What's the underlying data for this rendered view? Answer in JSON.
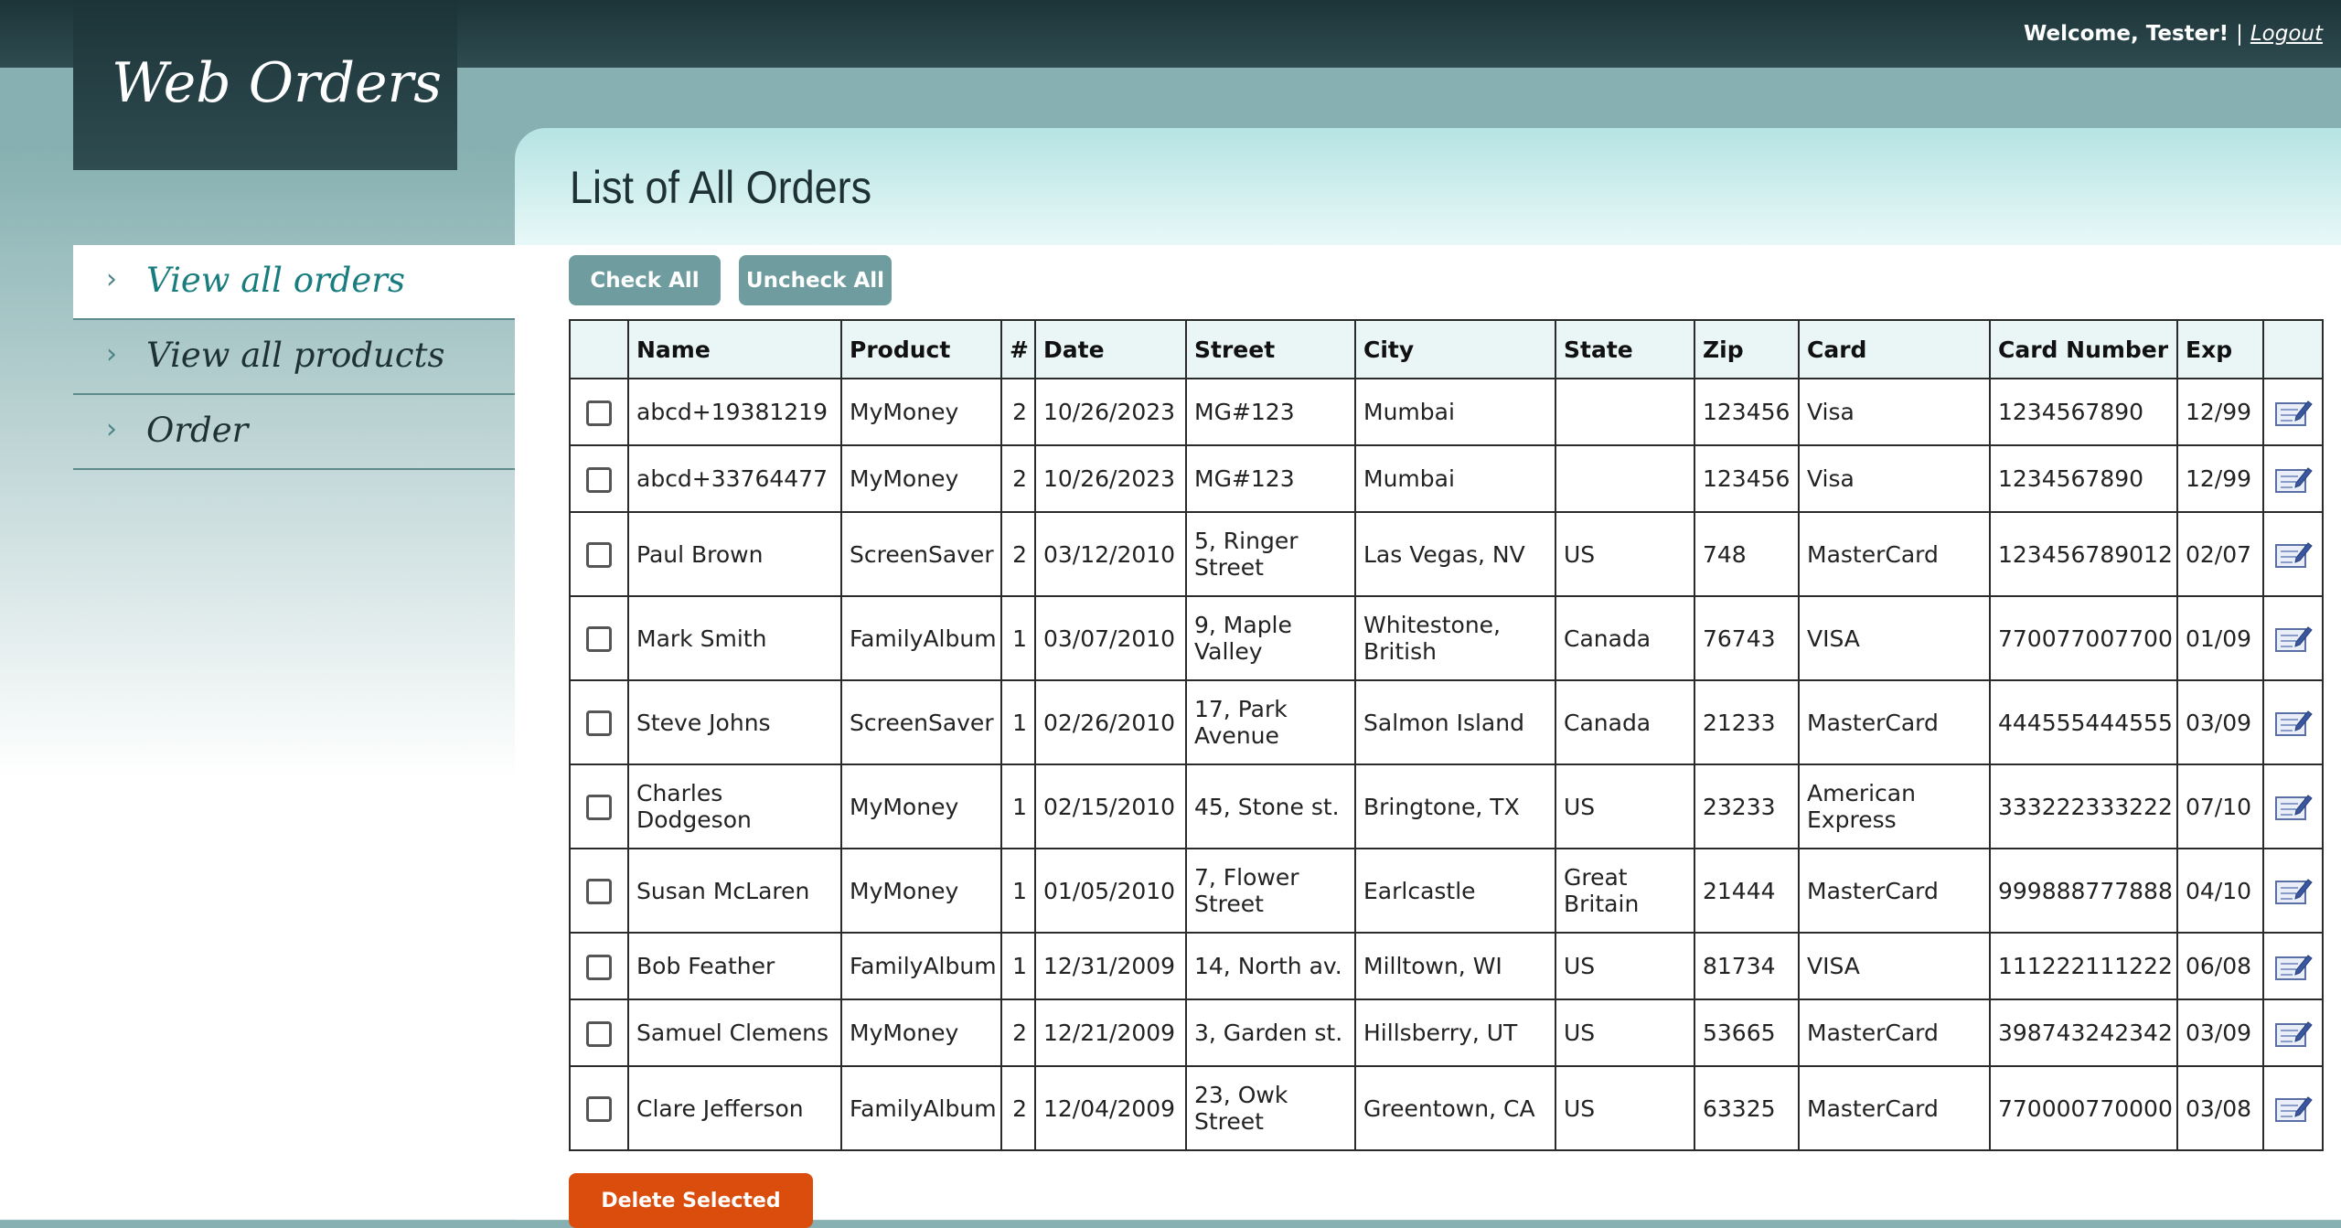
{
  "header": {
    "welcome": "Welcome, Tester!",
    "separator": "|",
    "logout": "Logout",
    "app_title": "Web Orders"
  },
  "page_title": "List of All Orders",
  "nav": {
    "items": [
      {
        "label": "View all orders",
        "active": true,
        "icon": "chevron-right-icon"
      },
      {
        "label": "View all products",
        "active": false,
        "icon": "chevron-right-icon"
      },
      {
        "label": "Order",
        "active": false,
        "icon": "chevron-right-icon"
      }
    ]
  },
  "actions": {
    "check_all": "Check All",
    "uncheck_all": "Uncheck All",
    "delete_selected": "Delete Selected"
  },
  "table": {
    "columns": [
      "",
      "Name",
      "Product",
      "#",
      "Date",
      "Street",
      "City",
      "State",
      "Zip",
      "Card",
      "Card Number",
      "Exp",
      ""
    ],
    "rows": [
      {
        "name": "abcd+19381219",
        "product": "MyMoney",
        "qty": "2",
        "date": "10/26/2023",
        "street": "MG#123",
        "city": "Mumbai",
        "state": "",
        "zip": "123456",
        "card": "Visa",
        "card_number": "1234567890",
        "exp": "12/99"
      },
      {
        "name": "abcd+33764477",
        "product": "MyMoney",
        "qty": "2",
        "date": "10/26/2023",
        "street": "MG#123",
        "city": "Mumbai",
        "state": "",
        "zip": "123456",
        "card": "Visa",
        "card_number": "1234567890",
        "exp": "12/99"
      },
      {
        "name": "Paul Brown",
        "product": "ScreenSaver",
        "qty": "2",
        "date": "03/12/2010",
        "street": "5, Ringer Street",
        "city": "Las Vegas, NV",
        "state": "US",
        "zip": "748",
        "card": "MasterCard",
        "card_number": "123456789012",
        "exp": "02/07"
      },
      {
        "name": "Mark Smith",
        "product": "FamilyAlbum",
        "qty": "1",
        "date": "03/07/2010",
        "street": "9, Maple Valley",
        "city": "Whitestone, British",
        "state": "Canada",
        "zip": "76743",
        "card": "VISA",
        "card_number": "770077007700",
        "exp": "01/09"
      },
      {
        "name": "Steve Johns",
        "product": "ScreenSaver",
        "qty": "1",
        "date": "02/26/2010",
        "street": "17, Park Avenue",
        "city": "Salmon Island",
        "state": "Canada",
        "zip": "21233",
        "card": "MasterCard",
        "card_number": "444555444555",
        "exp": "03/09"
      },
      {
        "name": "Charles Dodgeson",
        "product": "MyMoney",
        "qty": "1",
        "date": "02/15/2010",
        "street": "45, Stone st.",
        "city": "Bringtone, TX",
        "state": "US",
        "zip": "23233",
        "card": "American Express",
        "card_number": "333222333222",
        "exp": "07/10"
      },
      {
        "name": "Susan McLaren",
        "product": "MyMoney",
        "qty": "1",
        "date": "01/05/2010",
        "street": "7, Flower Street",
        "city": "Earlcastle",
        "state": "Great Britain",
        "zip": "21444",
        "card": "MasterCard",
        "card_number": "999888777888",
        "exp": "04/10"
      },
      {
        "name": "Bob Feather",
        "product": "FamilyAlbum",
        "qty": "1",
        "date": "12/31/2009",
        "street": "14, North av.",
        "city": "Milltown, WI",
        "state": "US",
        "zip": "81734",
        "card": "VISA",
        "card_number": "111222111222",
        "exp": "06/08"
      },
      {
        "name": "Samuel Clemens",
        "product": "MyMoney",
        "qty": "2",
        "date": "12/21/2009",
        "street": "3, Garden st.",
        "city": "Hillsberry, UT",
        "state": "US",
        "zip": "53665",
        "card": "MasterCard",
        "card_number": "398743242342",
        "exp": "03/09"
      },
      {
        "name": "Clare Jefferson",
        "product": "FamilyAlbum",
        "qty": "2",
        "date": "12/04/2009",
        "street": "23, Owk Street",
        "city": "Greentown, CA",
        "state": "US",
        "zip": "63325",
        "card": "MasterCard",
        "card_number": "770000770000",
        "exp": "03/08"
      }
    ]
  }
}
